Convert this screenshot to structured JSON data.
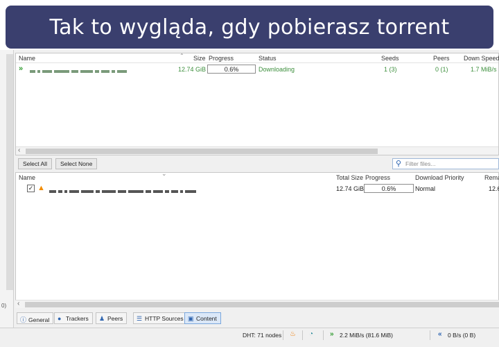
{
  "banner": {
    "title": "Tak to wygląda, gdy pobierasz torrent"
  },
  "left_strip": {
    "edge_text": "0)"
  },
  "torrent_list": {
    "columns": {
      "name": "Name",
      "size": "Size",
      "progress": "Progress",
      "status": "Status",
      "seeds": "Seeds",
      "peers": "Peers",
      "down_speed": "Down Speed"
    },
    "rows": [
      {
        "size": "12.74 GiB",
        "progress": "0.6%",
        "status": "Downloading",
        "seeds": "1 (3)",
        "peers": "0 (1)",
        "down_speed": "1.7 MiB/s"
      }
    ]
  },
  "files_toolbar": {
    "select_all": "Select All",
    "select_none": "Select None",
    "filter_placeholder": "Filter files..."
  },
  "files_list": {
    "columns": {
      "name": "Name",
      "total_size": "Total Size",
      "progress": "Progress",
      "priority": "Download Priority",
      "remaining": "Rema"
    },
    "rows": [
      {
        "checked": "✓",
        "total_size": "12.74 GiB",
        "progress": "0.6%",
        "priority": "Normal",
        "remaining": "12.6"
      }
    ]
  },
  "tabs": [
    {
      "label": "General",
      "icon": "info-icon"
    },
    {
      "label": "Trackers",
      "icon": "pin-icon"
    },
    {
      "label": "Peers",
      "icon": "people-icon"
    },
    {
      "label": "HTTP Sources",
      "icon": "database-icon"
    },
    {
      "label": "Content",
      "icon": "folder-icon"
    }
  ],
  "status_bar": {
    "dht": "DHT: 71 nodes",
    "download": "2.2 MiB/s (81.6 MiB)",
    "upload": "0 B/s (0 B)"
  },
  "colors": {
    "banner": "#3a3f6e",
    "downloading": "#3d8f3d",
    "accent": "#3166b0"
  }
}
